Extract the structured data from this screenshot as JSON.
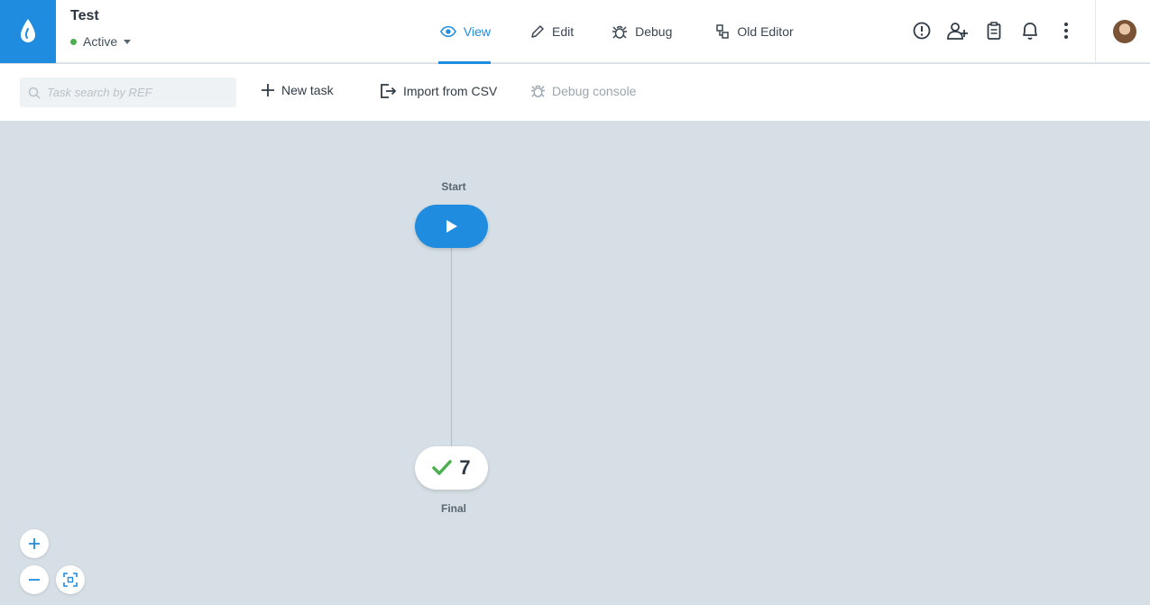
{
  "app": {
    "logo_icon": "drop-icon",
    "brand_color": "#1f8ce0"
  },
  "process": {
    "title": "Test",
    "status": "Active",
    "status_color": "#4caf50"
  },
  "tabs": [
    {
      "label": "View",
      "icon": "eye-icon",
      "active": true
    },
    {
      "label": "Edit",
      "icon": "pencil-icon",
      "active": false
    },
    {
      "label": "Debug",
      "icon": "bug-icon",
      "active": false
    },
    {
      "label": "Old Editor",
      "icon": "old-editor-icon",
      "active": false
    }
  ],
  "header_icons": [
    "alert-icon",
    "add-user-icon",
    "clipboard-icon",
    "bell-icon",
    "more-icon"
  ],
  "toolbar": {
    "search_placeholder": "Task search by REF",
    "search_value": "",
    "new_task": "New task",
    "import_csv": "Import from CSV",
    "debug_console": "Debug console"
  },
  "flow": {
    "start_label": "Start",
    "final_label": "Final",
    "final_count": "7"
  }
}
